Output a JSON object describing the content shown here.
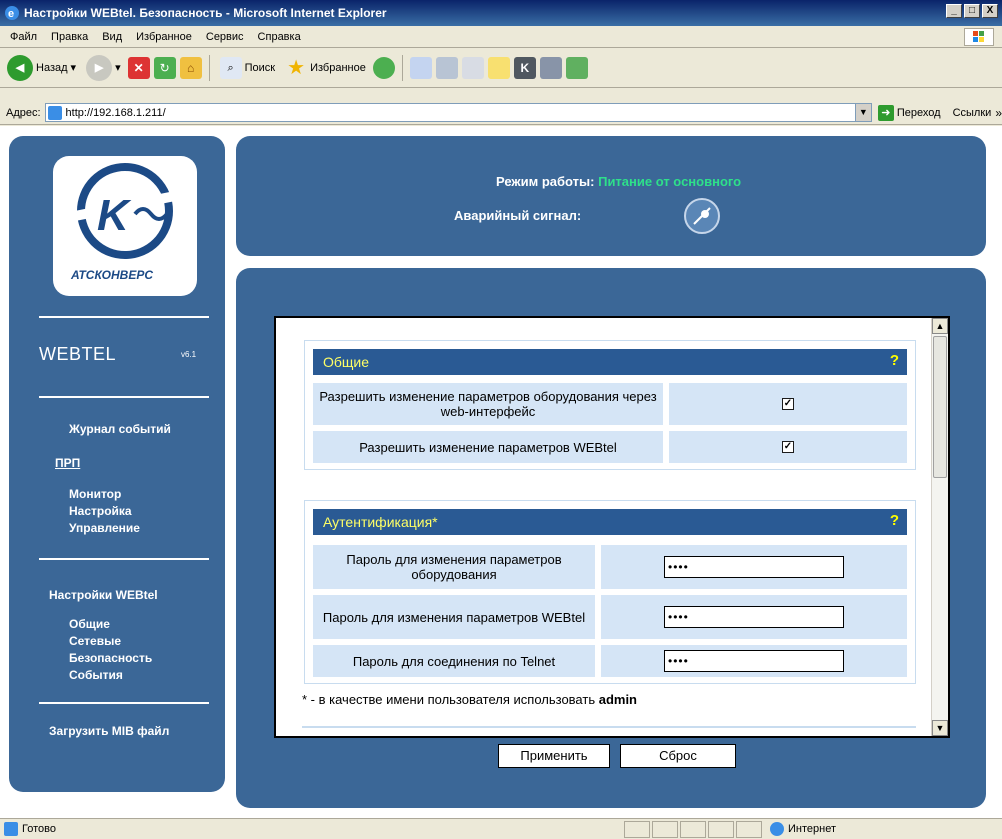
{
  "window": {
    "title": "Настройки WEBtel. Безопасность - Microsoft Internet Explorer",
    "controls": [
      "_",
      "□",
      "X"
    ]
  },
  "menu": [
    "Файл",
    "Правка",
    "Вид",
    "Избранное",
    "Сервис",
    "Справка"
  ],
  "toolbar": {
    "back": "Назад",
    "search": "Поиск",
    "favorites": "Избранное"
  },
  "address": {
    "label": "Адрес:",
    "url": "http://192.168.1.211/",
    "go": "Переход",
    "links": "Ссылки"
  },
  "sidebar": {
    "logo_text": "АТСКОНВЕРС",
    "product": "WEBTEL",
    "version": "v6.1",
    "event_log": "Журнал событий",
    "prp": "ПРП",
    "prp_items": [
      "Монитор",
      "Настройка",
      "Управление"
    ],
    "webtel_settings": "Настройки WEBtel",
    "webtel_items": [
      "Общие",
      "Сетевые",
      "Безопасность",
      "События"
    ],
    "load_mib": "Загрузить MIB файл"
  },
  "header": {
    "mode_label": "Режим работы:",
    "mode_value": "Питание от основного",
    "alarm_label": "Аварийный сигнал:"
  },
  "general": {
    "title": "Общие",
    "help": "?",
    "row1_label": "Разрешить изменение параметров оборудования через web-интерфейс",
    "row1_checked": "✓",
    "row2_label": "Разрешить изменение параметров WEBtel",
    "row2_checked": "✓"
  },
  "auth": {
    "title": "Аутентификация*",
    "help": "?",
    "row1_label": "Пароль для изменения параметров оборудования",
    "row1_value": "••••",
    "row2_label": "Пароль для изменения параметров WEBtel",
    "row2_value": "••••",
    "row3_label": "Пароль для соединения по Telnet",
    "row3_value": "••••"
  },
  "footnote": {
    "text": "* - в качестве имени пользователя использовать ",
    "bold": "admin"
  },
  "buttons": {
    "apply": "Применить",
    "reset": "Сброс"
  },
  "status": {
    "left": "Готово",
    "zone": "Интернет"
  }
}
